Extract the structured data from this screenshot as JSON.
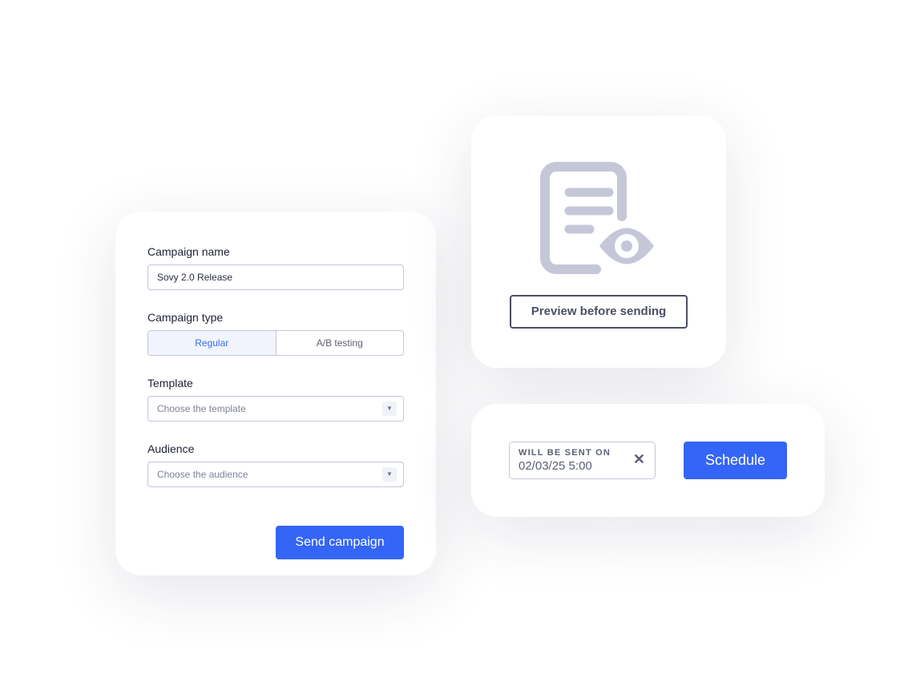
{
  "form": {
    "name_label": "Campaign name",
    "name_value": "Sovy 2.0 Release",
    "type_label": "Campaign type",
    "type_options": [
      "Regular",
      "A/B testing"
    ],
    "type_selected": "Regular",
    "template_label": "Template",
    "template_placeholder": "Choose the template",
    "audience_label": "Audience",
    "audience_placeholder": "Choose the audience",
    "send_label": "Send campaign"
  },
  "preview": {
    "icon": "document-eye-icon",
    "button_label": "Preview before sending"
  },
  "schedule": {
    "field_label": "WILL BE SENT ON",
    "field_value": "02/03/25 5:00",
    "clear_icon": "close-icon",
    "button_label": "Schedule"
  },
  "colors": {
    "accent": "#3565f6",
    "icon_gray": "#c5c7d9"
  }
}
